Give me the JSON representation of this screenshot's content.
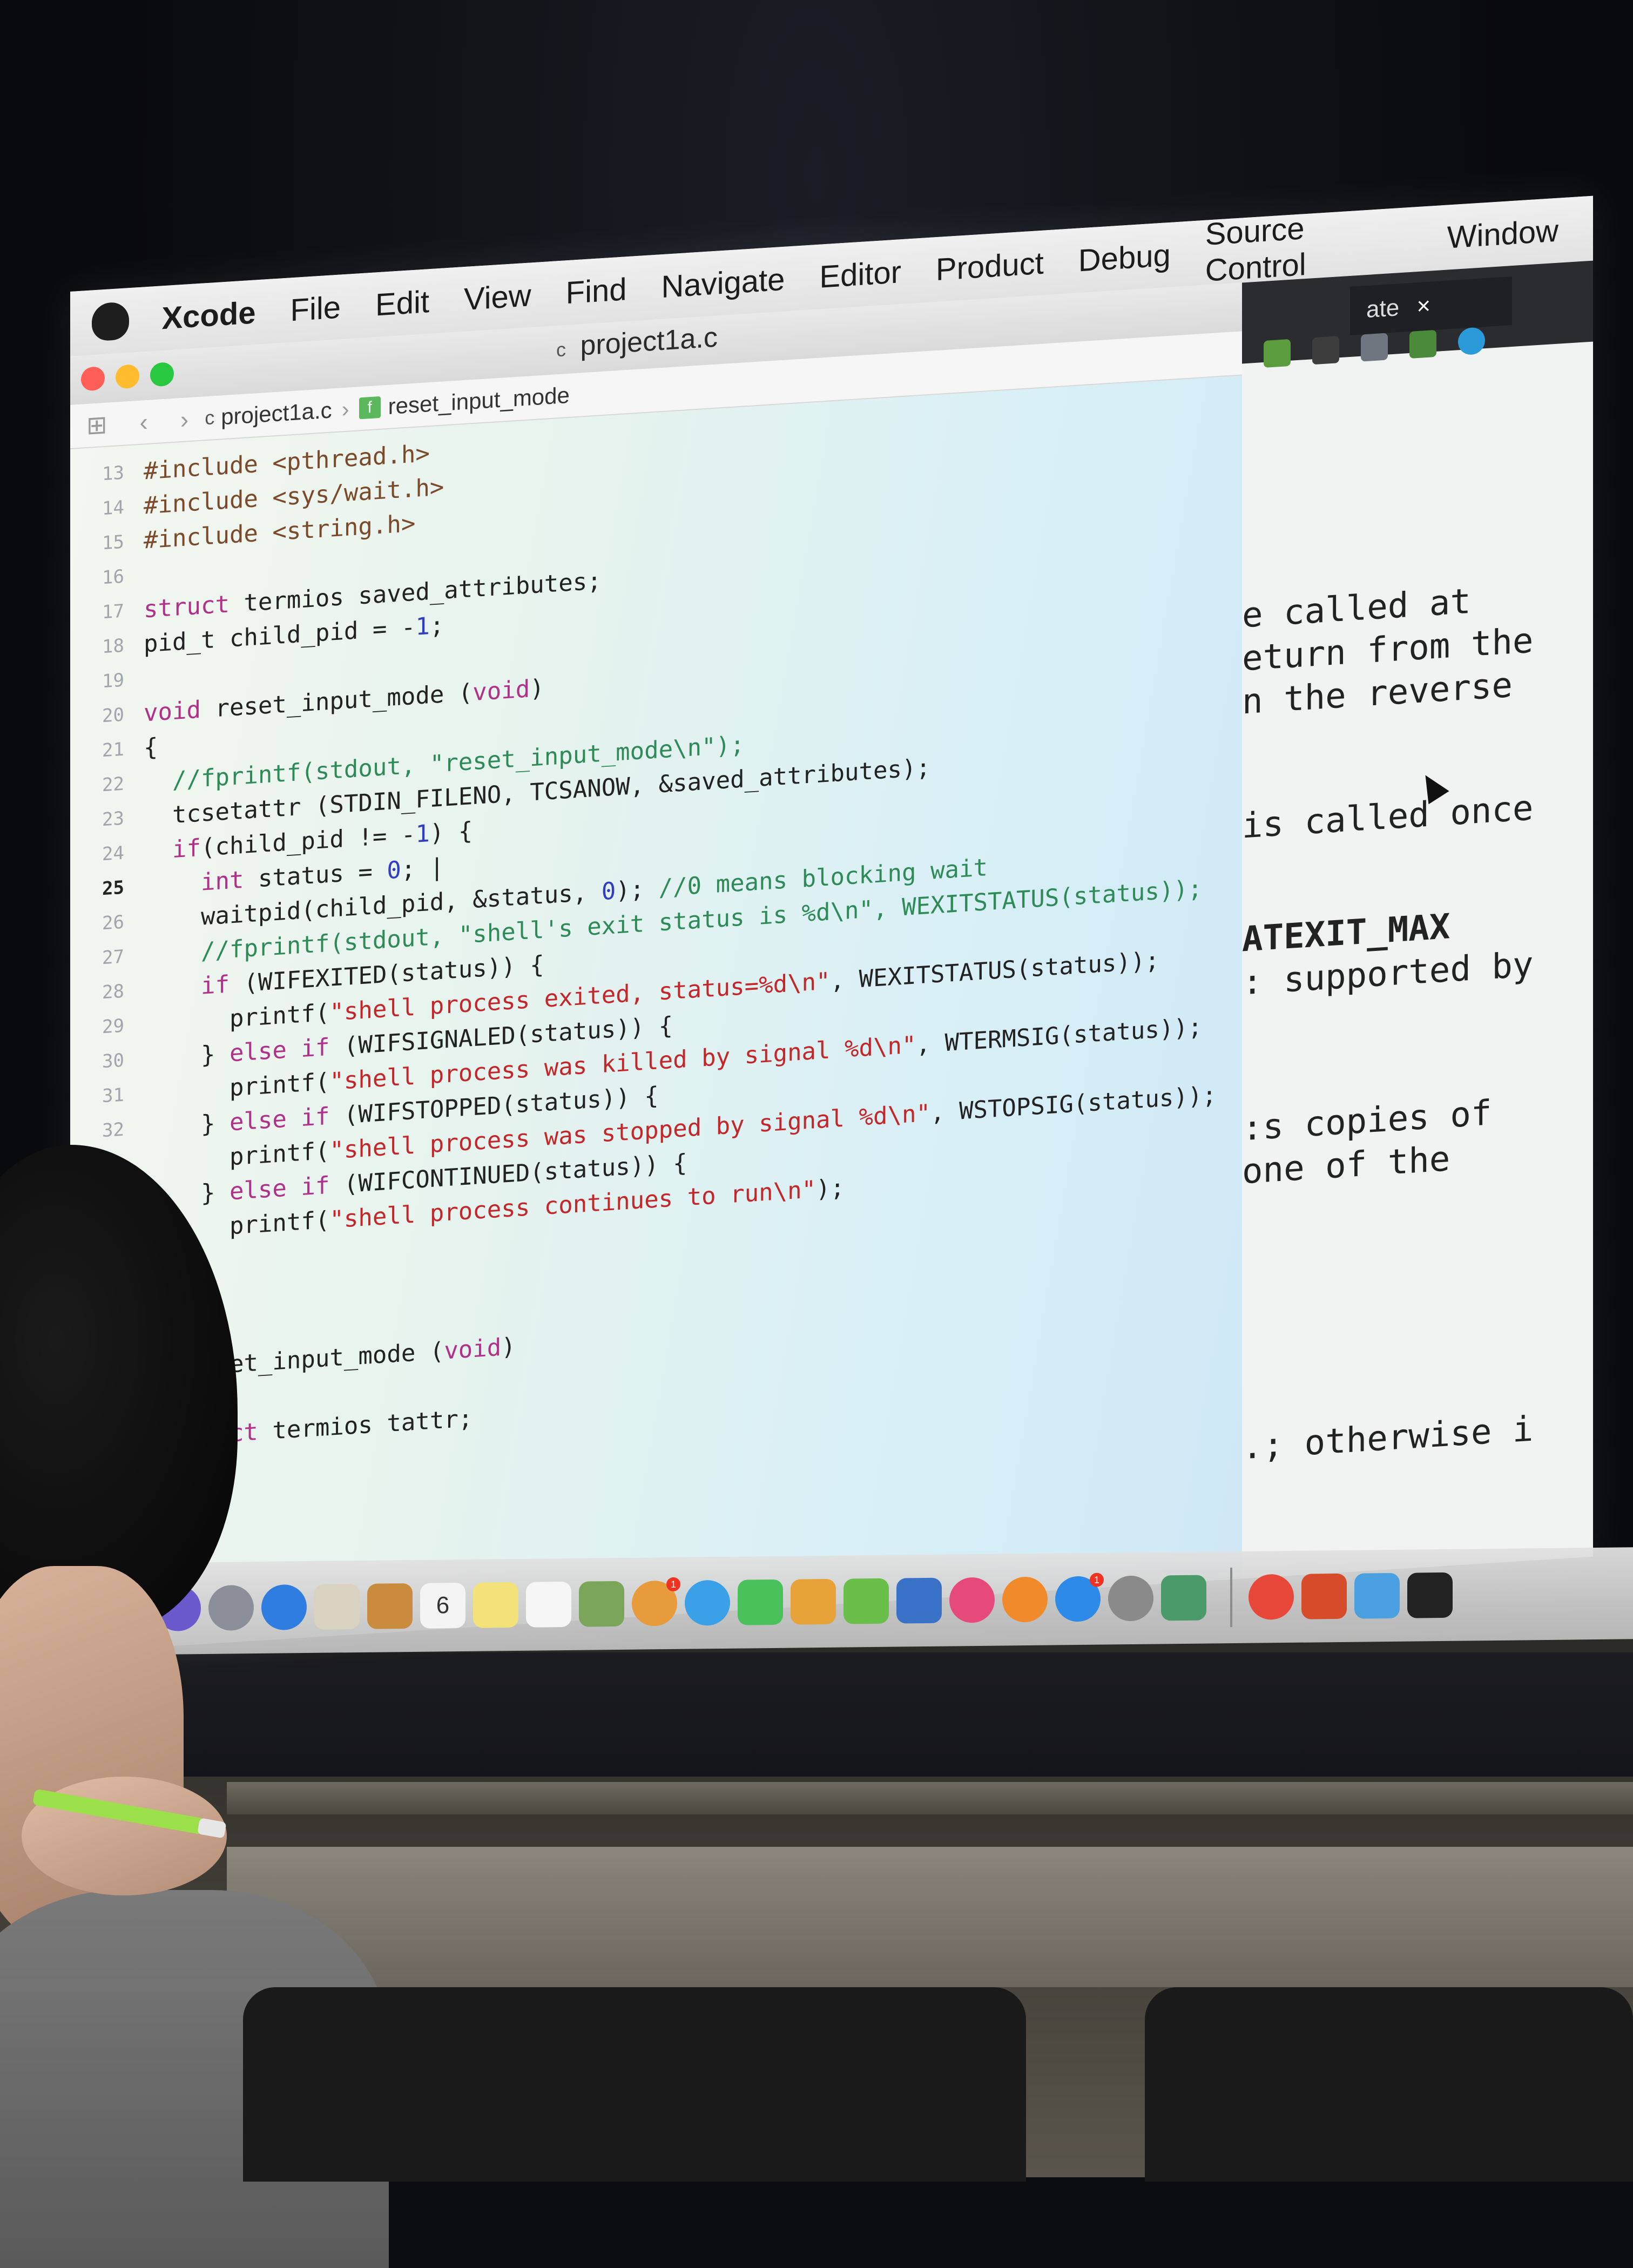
{
  "menubar": {
    "app": "Xcode",
    "items": [
      "File",
      "Edit",
      "View",
      "Find",
      "Navigate",
      "Editor",
      "Product",
      "Debug",
      "Source Control",
      "Window"
    ]
  },
  "window": {
    "title": "project1a.c",
    "title_icon": "c",
    "jumpbar": {
      "file": "project1a.c",
      "file_icon": "c",
      "function": "reset_input_mode",
      "function_icon": "f"
    }
  },
  "code": {
    "lines": [
      {
        "n": "13",
        "text": "#include <pthread.h>"
      },
      {
        "n": "14",
        "text": "#include <sys/wait.h>"
      },
      {
        "n": "15",
        "text": "#include <string.h>"
      },
      {
        "n": "16",
        "text": ""
      },
      {
        "n": "17",
        "text": "struct termios saved_attributes;"
      },
      {
        "n": "18",
        "text": "pid_t child_pid = -1;"
      },
      {
        "n": "19",
        "text": ""
      },
      {
        "n": "20",
        "text": "void reset_input_mode (void)"
      },
      {
        "n": "21",
        "text": "{"
      },
      {
        "n": "22",
        "text": "  //fprintf(stdout, \"reset_input_mode\\n\");"
      },
      {
        "n": "23",
        "text": "  tcsetattr (STDIN_FILENO, TCSANOW, &saved_attributes);"
      },
      {
        "n": "24",
        "text": "  if(child_pid != -1) {"
      },
      {
        "n": "25",
        "text": "    int status = 0; |"
      },
      {
        "n": "26",
        "text": "    waitpid(child_pid, &status, 0); //0 means blocking wait"
      },
      {
        "n": "27",
        "text": "    //fprintf(stdout, \"shell's exit status is %d\\n\", WEXITSTATUS(status));"
      },
      {
        "n": "28",
        "text": "    if (WIFEXITED(status)) {"
      },
      {
        "n": "29",
        "text": "      printf(\"shell process exited, status=%d\\n\", WEXITSTATUS(status));"
      },
      {
        "n": "30",
        "text": "    } else if (WIFSIGNALED(status)) {"
      },
      {
        "n": "31",
        "text": "      printf(\"shell process was killed by signal %d\\n\", WTERMSIG(status));"
      },
      {
        "n": "32",
        "text": "    } else if (WIFSTOPPED(status)) {"
      },
      {
        "n": "33",
        "text": "      printf(\"shell process was stopped by signal %d\\n\", WSTOPSIG(status));"
      },
      {
        "n": "",
        "text": "    } else if (WIFCONTINUED(status)) {"
      },
      {
        "n": "",
        "text": "      printf(\"shell process continues to run\\n\");"
      },
      {
        "n": "",
        "text": "  }"
      },
      {
        "n": "",
        "text": ""
      },
      {
        "n": "",
        "text": ""
      },
      {
        "n": "",
        "text": "void set_input_mode (void)"
      },
      {
        "n": "",
        "text": "{"
      },
      {
        "n": "",
        "text": "  struct termios tattr;"
      }
    ],
    "current_line": "25"
  },
  "doc": {
    "tab_label": "ate",
    "tab_close": "×",
    "lines": [
      "e called at",
      "eturn from the",
      "n the reverse",
      "is called once",
      "ATEXIT_MAX",
      ": supported by",
      ":s copies of",
      "one of the",
      ".; otherwise i"
    ]
  },
  "dock": {
    "icons": [
      "finder-icon",
      "siri-icon",
      "launchpad-icon",
      "safari-icon",
      "mail-stamp-icon",
      "contacts-icon",
      "calendar-icon",
      "notes-icon",
      "reminders-icon",
      "photo-booth-icon",
      "photos-icon",
      "messages-icon",
      "facetime-icon",
      "pages-icon",
      "numbers-icon",
      "keynote-icon",
      "itunes-icon",
      "ibooks-icon",
      "app-store-icon",
      "system-preferences-icon",
      "instruments-icon",
      "chrome-icon",
      "powerpoint-icon",
      "xcode-icon",
      "terminal-icon"
    ],
    "calendar_day": "6",
    "app_store_badge": "1",
    "photos_badge": "1"
  },
  "colors": {
    "keyword": "#b0308a",
    "string": "#c4262a",
    "comment": "#2e8b57",
    "number": "#2f3ec4",
    "close": "#ff5f57",
    "minimize": "#febc2e",
    "zoom": "#28c840"
  }
}
